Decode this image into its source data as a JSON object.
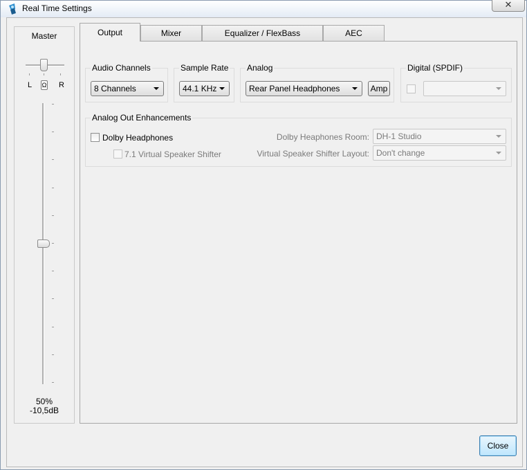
{
  "window": {
    "title": "Real Time Settings"
  },
  "master": {
    "title": "Master",
    "balance_left": "L",
    "balance_right": "R",
    "balance_center": "Ω",
    "volume_fraction": 0.5,
    "volume_percent": "50%",
    "volume_db": "-10,5dB"
  },
  "tabs": [
    {
      "label": "Output",
      "active": true
    },
    {
      "label": "Mixer",
      "active": false
    },
    {
      "label": "Equalizer / FlexBass",
      "active": false
    },
    {
      "label": "AEC",
      "active": false
    }
  ],
  "output": {
    "audio_channels": {
      "title": "Audio Channels",
      "value": "8 Channels"
    },
    "sample_rate": {
      "title": "Sample Rate",
      "value": "44.1 KHz"
    },
    "analog": {
      "title": "Analog",
      "value": "Rear Panel Headphones",
      "amp_label": "Amp"
    },
    "digital": {
      "title": "Digital (SPDIF)",
      "value": ""
    },
    "enhancements": {
      "title": "Analog Out Enhancements",
      "dolby_headphones_label": "Dolby Headphones",
      "virtual_speaker_label": "7.1 Virtual Speaker Shifter",
      "room_label": "Dolby Heaphones Room:",
      "room_value": "DH-1 Studio",
      "layout_label": "Virtual Speaker Shifter Layout:",
      "layout_value": "Don't change"
    }
  },
  "buttons": {
    "close": "Close",
    "close_x": "✕"
  },
  "colors": {
    "accent": "#3c7fb1",
    "window_bg": "#f0f0f0"
  }
}
